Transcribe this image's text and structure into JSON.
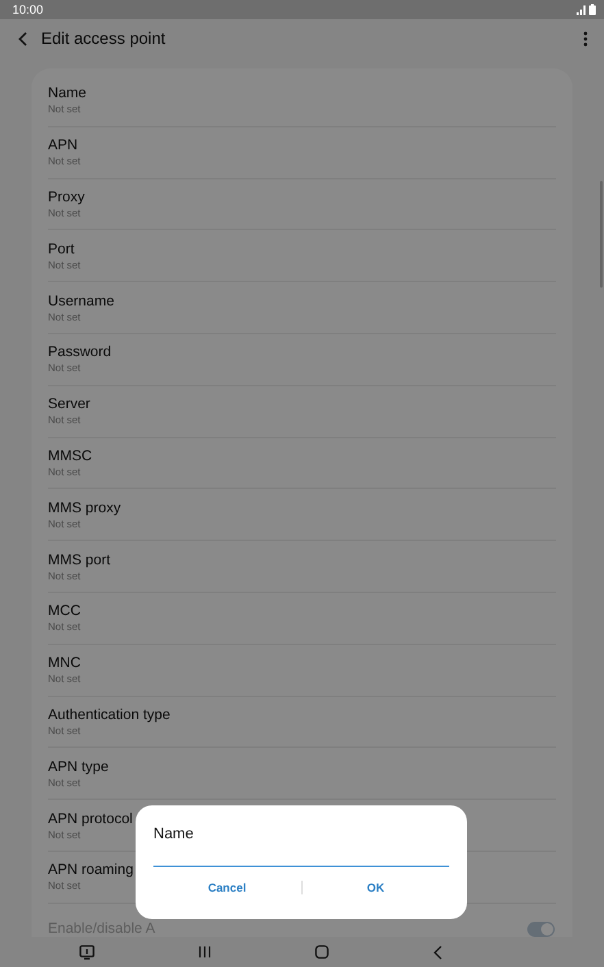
{
  "status_bar": {
    "time": "10:00"
  },
  "header": {
    "title": "Edit access point"
  },
  "settings": [
    {
      "kind": "text",
      "title": "Name",
      "value": "Not set",
      "disabled": false
    },
    {
      "kind": "text",
      "title": "APN",
      "value": "Not set",
      "disabled": false
    },
    {
      "kind": "text",
      "title": "Proxy",
      "value": "Not set",
      "disabled": false
    },
    {
      "kind": "text",
      "title": "Port",
      "value": "Not set",
      "disabled": false
    },
    {
      "kind": "text",
      "title": "Username",
      "value": "Not set",
      "disabled": false
    },
    {
      "kind": "text",
      "title": "Password",
      "value": "Not set",
      "disabled": false
    },
    {
      "kind": "text",
      "title": "Server",
      "value": "Not set",
      "disabled": false
    },
    {
      "kind": "text",
      "title": "MMSC",
      "value": "Not set",
      "disabled": false
    },
    {
      "kind": "text",
      "title": "MMS proxy",
      "value": "Not set",
      "disabled": false
    },
    {
      "kind": "text",
      "title": "MMS port",
      "value": "Not set",
      "disabled": false
    },
    {
      "kind": "text",
      "title": "MCC",
      "value": "Not set",
      "disabled": false
    },
    {
      "kind": "text",
      "title": "MNC",
      "value": "Not set",
      "disabled": false
    },
    {
      "kind": "text",
      "title": "Authentication type",
      "value": "Not set",
      "disabled": false
    },
    {
      "kind": "text",
      "title": "APN type",
      "value": "Not set",
      "disabled": false
    },
    {
      "kind": "text",
      "title": "APN protocol",
      "value": "Not set",
      "disabled": false
    },
    {
      "kind": "text",
      "title": "APN roaming",
      "value": "Not set",
      "disabled": false
    },
    {
      "kind": "toggle",
      "title": "Enable/disable A",
      "disabled": true,
      "on": true
    }
  ],
  "dialog": {
    "title": "Name",
    "buttons": [
      "Cancel",
      "OK"
    ]
  }
}
